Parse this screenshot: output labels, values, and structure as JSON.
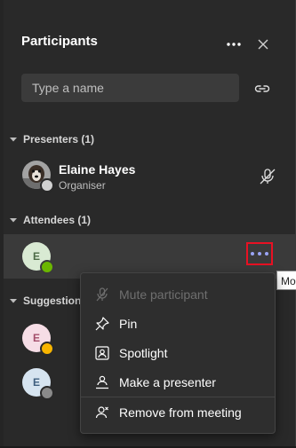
{
  "header": {
    "title": "Participants",
    "more_icon": "more-horizontal-icon",
    "close_icon": "close-icon"
  },
  "search": {
    "placeholder": "Type a name",
    "value": "",
    "share_link_icon": "link-icon"
  },
  "sections": {
    "presenters": {
      "label": "Presenters (1)"
    },
    "attendees": {
      "label": "Attendees (1)"
    },
    "suggestions": {
      "label": "Suggestions"
    }
  },
  "presenter": {
    "name": "Elaine Hayes",
    "role": "Organiser",
    "status_icon": "mic-off-icon"
  },
  "attendee": {
    "initial": "E",
    "avatar_color": "#d9ead3",
    "presence_color": "#6bb700"
  },
  "suggestions_list": [
    {
      "initial": "E",
      "avatar_color": "#f6dde6",
      "presence_color": "#f8b500"
    },
    {
      "initial": "E",
      "avatar_color": "#d6e4f0",
      "presence_color": "#8a8a8a"
    }
  ],
  "context_menu": {
    "items": [
      {
        "label": "Mute participant",
        "icon": "mic-off-icon",
        "enabled": false
      },
      {
        "label": "Pin",
        "icon": "pin-icon",
        "enabled": true
      },
      {
        "label": "Spotlight",
        "icon": "spotlight-icon",
        "enabled": true
      },
      {
        "label": "Make a presenter",
        "icon": "presenter-icon",
        "enabled": true
      },
      {
        "label": "Remove from meeting",
        "icon": "remove-person-icon",
        "enabled": true
      }
    ]
  },
  "tooltip": {
    "text": "Mo"
  },
  "colors": {
    "background": "#292929",
    "highlight": "#3a3a3a",
    "accent": "#9aa4f5",
    "focus_outline": "#e81123"
  }
}
